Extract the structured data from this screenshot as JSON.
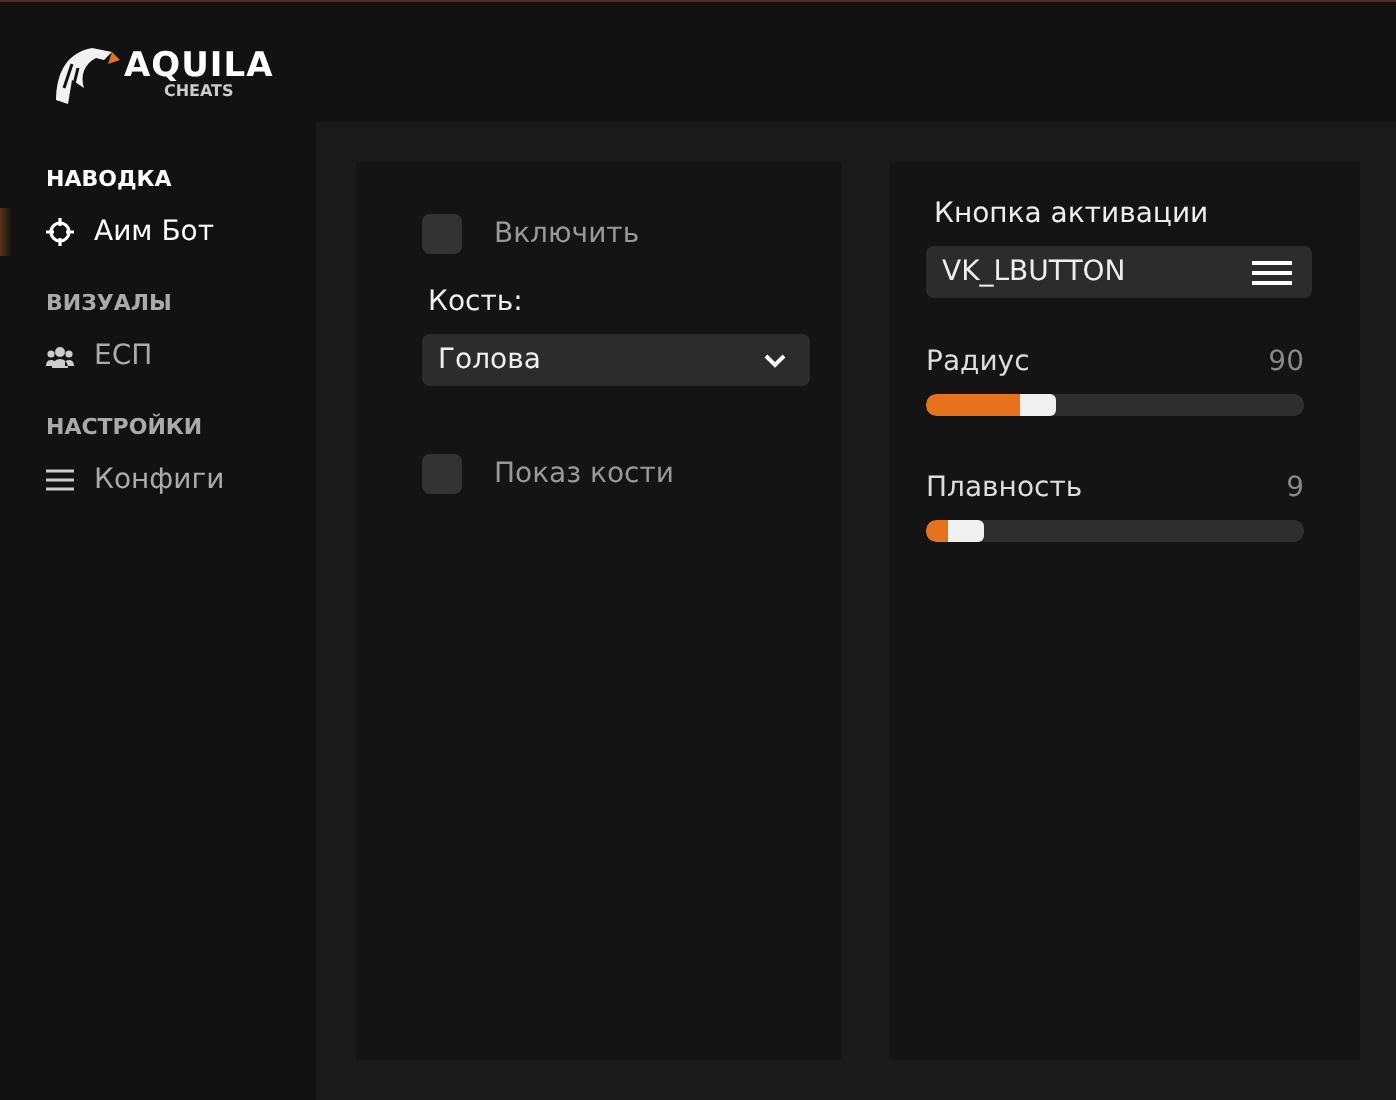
{
  "logo": {
    "title": "AQUILA",
    "subtitle": "CHEATS"
  },
  "sidebar": {
    "sections": [
      {
        "heading": "НАВОДКА",
        "items": [
          {
            "label": "Аим Бот",
            "selected": true
          }
        ]
      },
      {
        "heading": "ВИЗУАЛЫ",
        "items": [
          {
            "label": "ЕСП",
            "selected": false
          }
        ]
      },
      {
        "heading": "НАСТРОЙКИ",
        "items": [
          {
            "label": "Конфиги",
            "selected": false
          }
        ]
      }
    ]
  },
  "left_panel": {
    "controls": [
      {
        "kind": "checkbox",
        "label": "Включить",
        "checked": false
      },
      {
        "kind": "dropdown",
        "label": "Кость:",
        "value": "Голова"
      },
      {
        "kind": "checkbox",
        "label": "Показ кости",
        "checked": false
      }
    ]
  },
  "right_panel": {
    "controls": [
      {
        "kind": "keybind",
        "label": "Кнопка активации",
        "value": "VK_LBUTTON"
      },
      {
        "kind": "slider",
        "label": "Радиус",
        "reading": "90",
        "level": 0.25
      },
      {
        "kind": "slider",
        "label": "Плавность",
        "reading": "9",
        "level": 0.06
      }
    ]
  }
}
